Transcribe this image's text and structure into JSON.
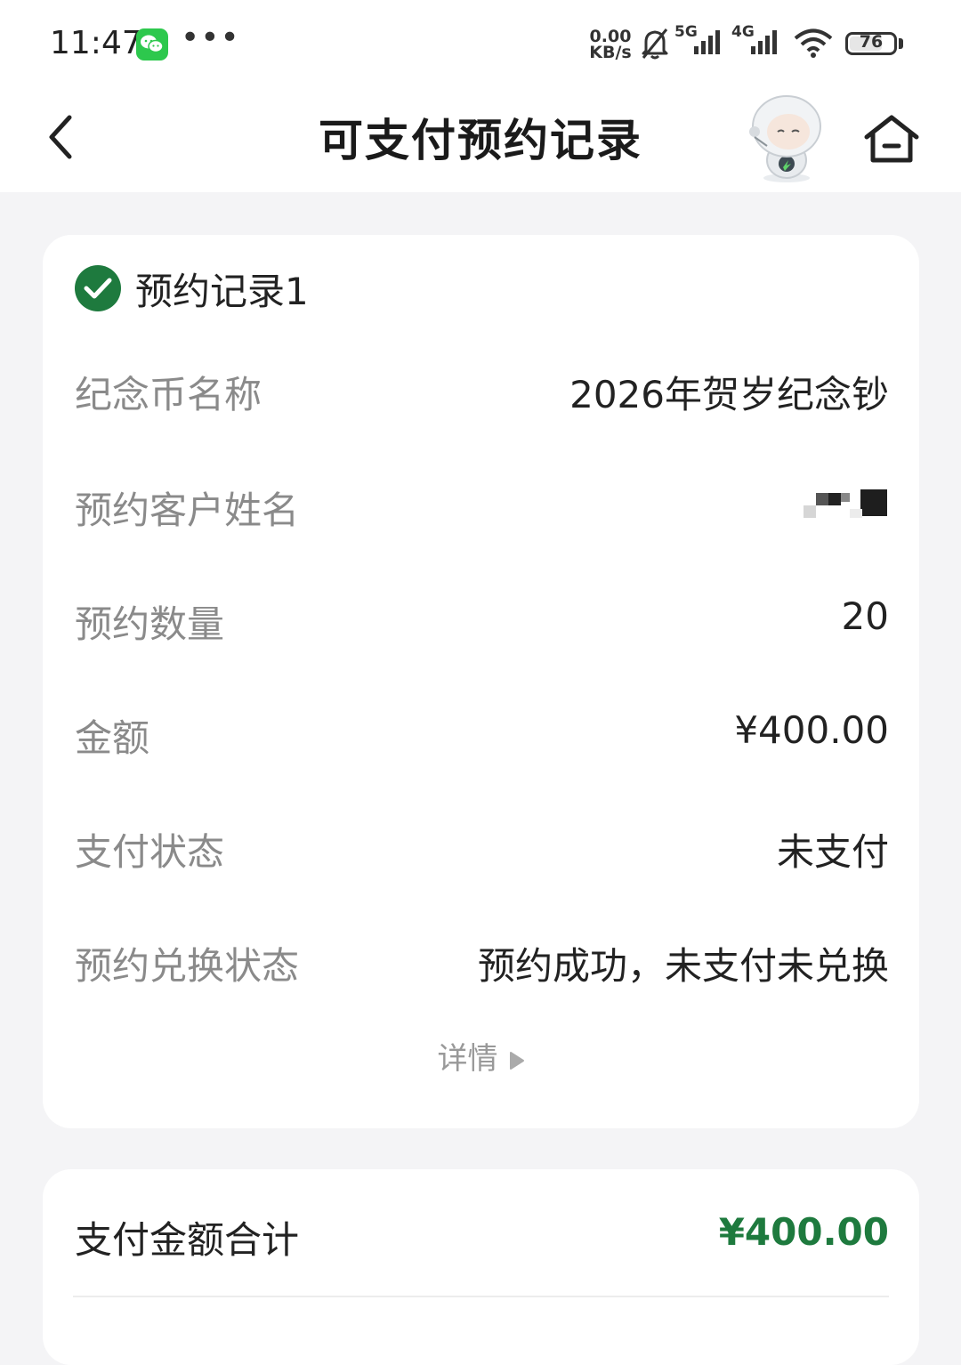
{
  "status_bar": {
    "time": "11:47",
    "net_speed_value": "0.00",
    "net_speed_unit": "KB/s",
    "signal_1": "5G",
    "signal_2": "4G",
    "battery": "76"
  },
  "nav": {
    "title": "可支付预约记录",
    "back_icon": "chevron-left-icon",
    "home_icon": "home-icon"
  },
  "record": {
    "title": "预约记录1",
    "rows": [
      {
        "label": "纪念币名称",
        "value": "2026年贺岁纪念钞"
      },
      {
        "label": "预约客户姓名",
        "value": ""
      },
      {
        "label": "预约数量",
        "value": "20"
      },
      {
        "label": "金额",
        "value": "¥400.00"
      },
      {
        "label": "支付状态",
        "value": "未支付"
      },
      {
        "label": "预约兑换状态",
        "value": "预约成功，未支付未兑换"
      }
    ],
    "details_label": "详情"
  },
  "summary": {
    "total_label": "支付金额合计",
    "total_value": "¥400.00"
  },
  "colors": {
    "accent_green": "#1e7a3e",
    "label_gray": "#8a8a8a",
    "background": "#f4f4f6"
  }
}
